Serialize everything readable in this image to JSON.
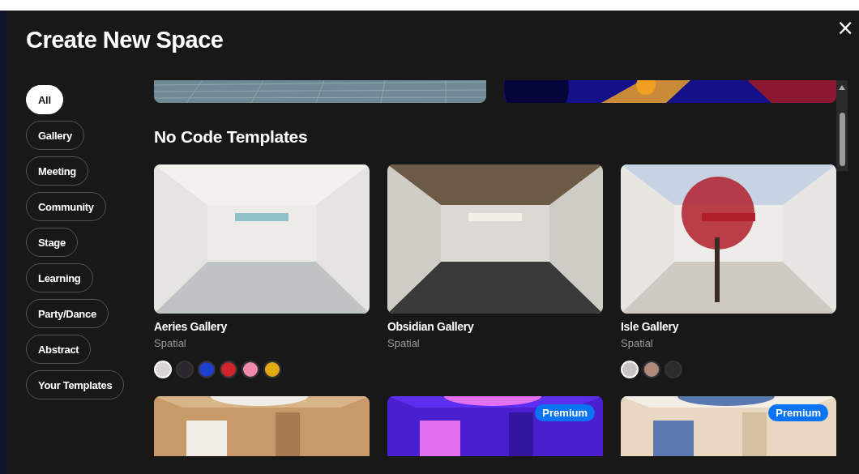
{
  "dialog": {
    "title": "Create New Space",
    "close": "×"
  },
  "categories": [
    {
      "label": "All",
      "selected": true
    },
    {
      "label": "Gallery",
      "selected": false
    },
    {
      "label": "Meeting",
      "selected": false
    },
    {
      "label": "Community",
      "selected": false
    },
    {
      "label": "Stage",
      "selected": false
    },
    {
      "label": "Learning",
      "selected": false
    },
    {
      "label": "Party/Dance",
      "selected": false
    },
    {
      "label": "Abstract",
      "selected": false
    },
    {
      "label": "Your Templates",
      "selected": false
    }
  ],
  "section": {
    "heading": "No Code Templates",
    "cards": [
      {
        "title": "Aeries Gallery",
        "subtitle": "Spatial",
        "swatches": [
          {
            "color": "#d8d6d2",
            "selected": true
          },
          {
            "color": "#2a2530",
            "selected": false
          },
          {
            "color": "#1f3fcf",
            "selected": false
          },
          {
            "color": "#d0252a",
            "selected": false
          },
          {
            "color": "#f08aa8",
            "selected": false
          },
          {
            "color": "#e2a912",
            "selected": false
          }
        ]
      },
      {
        "title": "Obsidian Gallery",
        "subtitle": "Spatial"
      },
      {
        "title": "Isle Gallery",
        "subtitle": "Spatial",
        "swatches": [
          {
            "color": "#c9c4c4",
            "selected": true
          },
          {
            "color": "#b08a78",
            "selected": false
          },
          {
            "color": "#2b2b2b",
            "selected": false
          }
        ]
      }
    ],
    "more_cards": [
      {
        "premium": false
      },
      {
        "premium": true,
        "badge": "Premium"
      },
      {
        "premium": true,
        "badge": "Premium"
      }
    ]
  }
}
